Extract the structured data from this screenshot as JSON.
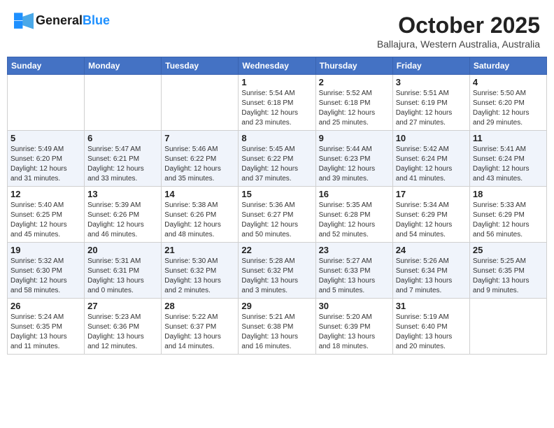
{
  "header": {
    "logo_line1": "General",
    "logo_line2": "Blue",
    "title": "October 2025",
    "location": "Ballajura, Western Australia, Australia"
  },
  "days_of_week": [
    "Sunday",
    "Monday",
    "Tuesday",
    "Wednesday",
    "Thursday",
    "Friday",
    "Saturday"
  ],
  "weeks": [
    [
      {
        "day": "",
        "info": ""
      },
      {
        "day": "",
        "info": ""
      },
      {
        "day": "",
        "info": ""
      },
      {
        "day": "1",
        "info": "Sunrise: 5:54 AM\nSunset: 6:18 PM\nDaylight: 12 hours\nand 23 minutes."
      },
      {
        "day": "2",
        "info": "Sunrise: 5:52 AM\nSunset: 6:18 PM\nDaylight: 12 hours\nand 25 minutes."
      },
      {
        "day": "3",
        "info": "Sunrise: 5:51 AM\nSunset: 6:19 PM\nDaylight: 12 hours\nand 27 minutes."
      },
      {
        "day": "4",
        "info": "Sunrise: 5:50 AM\nSunset: 6:20 PM\nDaylight: 12 hours\nand 29 minutes."
      }
    ],
    [
      {
        "day": "5",
        "info": "Sunrise: 5:49 AM\nSunset: 6:20 PM\nDaylight: 12 hours\nand 31 minutes."
      },
      {
        "day": "6",
        "info": "Sunrise: 5:47 AM\nSunset: 6:21 PM\nDaylight: 12 hours\nand 33 minutes."
      },
      {
        "day": "7",
        "info": "Sunrise: 5:46 AM\nSunset: 6:22 PM\nDaylight: 12 hours\nand 35 minutes."
      },
      {
        "day": "8",
        "info": "Sunrise: 5:45 AM\nSunset: 6:22 PM\nDaylight: 12 hours\nand 37 minutes."
      },
      {
        "day": "9",
        "info": "Sunrise: 5:44 AM\nSunset: 6:23 PM\nDaylight: 12 hours\nand 39 minutes."
      },
      {
        "day": "10",
        "info": "Sunrise: 5:42 AM\nSunset: 6:24 PM\nDaylight: 12 hours\nand 41 minutes."
      },
      {
        "day": "11",
        "info": "Sunrise: 5:41 AM\nSunset: 6:24 PM\nDaylight: 12 hours\nand 43 minutes."
      }
    ],
    [
      {
        "day": "12",
        "info": "Sunrise: 5:40 AM\nSunset: 6:25 PM\nDaylight: 12 hours\nand 45 minutes."
      },
      {
        "day": "13",
        "info": "Sunrise: 5:39 AM\nSunset: 6:26 PM\nDaylight: 12 hours\nand 46 minutes."
      },
      {
        "day": "14",
        "info": "Sunrise: 5:38 AM\nSunset: 6:26 PM\nDaylight: 12 hours\nand 48 minutes."
      },
      {
        "day": "15",
        "info": "Sunrise: 5:36 AM\nSunset: 6:27 PM\nDaylight: 12 hours\nand 50 minutes."
      },
      {
        "day": "16",
        "info": "Sunrise: 5:35 AM\nSunset: 6:28 PM\nDaylight: 12 hours\nand 52 minutes."
      },
      {
        "day": "17",
        "info": "Sunrise: 5:34 AM\nSunset: 6:29 PM\nDaylight: 12 hours\nand 54 minutes."
      },
      {
        "day": "18",
        "info": "Sunrise: 5:33 AM\nSunset: 6:29 PM\nDaylight: 12 hours\nand 56 minutes."
      }
    ],
    [
      {
        "day": "19",
        "info": "Sunrise: 5:32 AM\nSunset: 6:30 PM\nDaylight: 12 hours\nand 58 minutes."
      },
      {
        "day": "20",
        "info": "Sunrise: 5:31 AM\nSunset: 6:31 PM\nDaylight: 13 hours\nand 0 minutes."
      },
      {
        "day": "21",
        "info": "Sunrise: 5:30 AM\nSunset: 6:32 PM\nDaylight: 13 hours\nand 2 minutes."
      },
      {
        "day": "22",
        "info": "Sunrise: 5:28 AM\nSunset: 6:32 PM\nDaylight: 13 hours\nand 3 minutes."
      },
      {
        "day": "23",
        "info": "Sunrise: 5:27 AM\nSunset: 6:33 PM\nDaylight: 13 hours\nand 5 minutes."
      },
      {
        "day": "24",
        "info": "Sunrise: 5:26 AM\nSunset: 6:34 PM\nDaylight: 13 hours\nand 7 minutes."
      },
      {
        "day": "25",
        "info": "Sunrise: 5:25 AM\nSunset: 6:35 PM\nDaylight: 13 hours\nand 9 minutes."
      }
    ],
    [
      {
        "day": "26",
        "info": "Sunrise: 5:24 AM\nSunset: 6:35 PM\nDaylight: 13 hours\nand 11 minutes."
      },
      {
        "day": "27",
        "info": "Sunrise: 5:23 AM\nSunset: 6:36 PM\nDaylight: 13 hours\nand 12 minutes."
      },
      {
        "day": "28",
        "info": "Sunrise: 5:22 AM\nSunset: 6:37 PM\nDaylight: 13 hours\nand 14 minutes."
      },
      {
        "day": "29",
        "info": "Sunrise: 5:21 AM\nSunset: 6:38 PM\nDaylight: 13 hours\nand 16 minutes."
      },
      {
        "day": "30",
        "info": "Sunrise: 5:20 AM\nSunset: 6:39 PM\nDaylight: 13 hours\nand 18 minutes."
      },
      {
        "day": "31",
        "info": "Sunrise: 5:19 AM\nSunset: 6:40 PM\nDaylight: 13 hours\nand 20 minutes."
      },
      {
        "day": "",
        "info": ""
      }
    ]
  ]
}
